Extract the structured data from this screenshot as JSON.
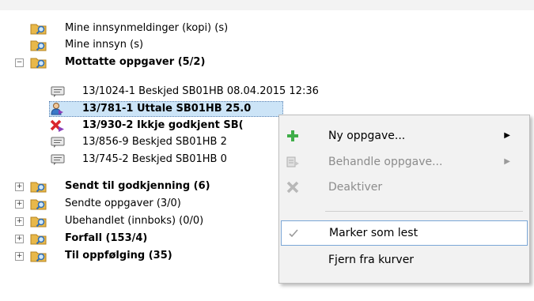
{
  "tree": {
    "rows": [
      {
        "label": "Mine innsynmeldinger (kopi) (s)"
      },
      {
        "label": "Mine innsyn (s)"
      },
      {
        "label": "Mottatte oppgaver (5/2)",
        "expander": "−"
      },
      {
        "label": "13/1024-1 Beskjed SB01HB  08.04.2015 12:36"
      },
      {
        "label": "13/781-1 Uttale SB01HB 25.0"
      },
      {
        "label": "13/930-2 Ikkje godkjent SB("
      },
      {
        "label": "13/856-9 Beskjed SB01HB  2"
      },
      {
        "label": "13/745-2 Beskjed SB01HB  0"
      },
      {
        "label": "Sendt til godkjenning (6)",
        "expander": "+"
      },
      {
        "label": "Sendte oppgaver (3/0)",
        "expander": "+"
      },
      {
        "label": "Ubehandlet (innboks) (0/0)",
        "expander": "+"
      },
      {
        "label": "Forfall (153/4)",
        "expander": "+"
      },
      {
        "label": "Til oppfølging (35)",
        "expander": "+"
      }
    ]
  },
  "context_menu": {
    "items": [
      {
        "label": "Ny oppgave...",
        "icon": "plus-icon",
        "submenu": "▶"
      },
      {
        "label": "Behandle oppgave...",
        "icon": "process-icon",
        "submenu": "▶"
      },
      {
        "label": "Deaktiver",
        "icon": "x-icon"
      },
      {
        "label": "Marker som lest",
        "icon": "check-icon"
      },
      {
        "label": "Fjern fra kurver"
      }
    ]
  },
  "colors": {
    "selection": "#cce4f7",
    "folder": "#e8b84a",
    "menu_bg": "#f2f2f2",
    "plus": "#3fae49",
    "error": "#d9262c"
  }
}
